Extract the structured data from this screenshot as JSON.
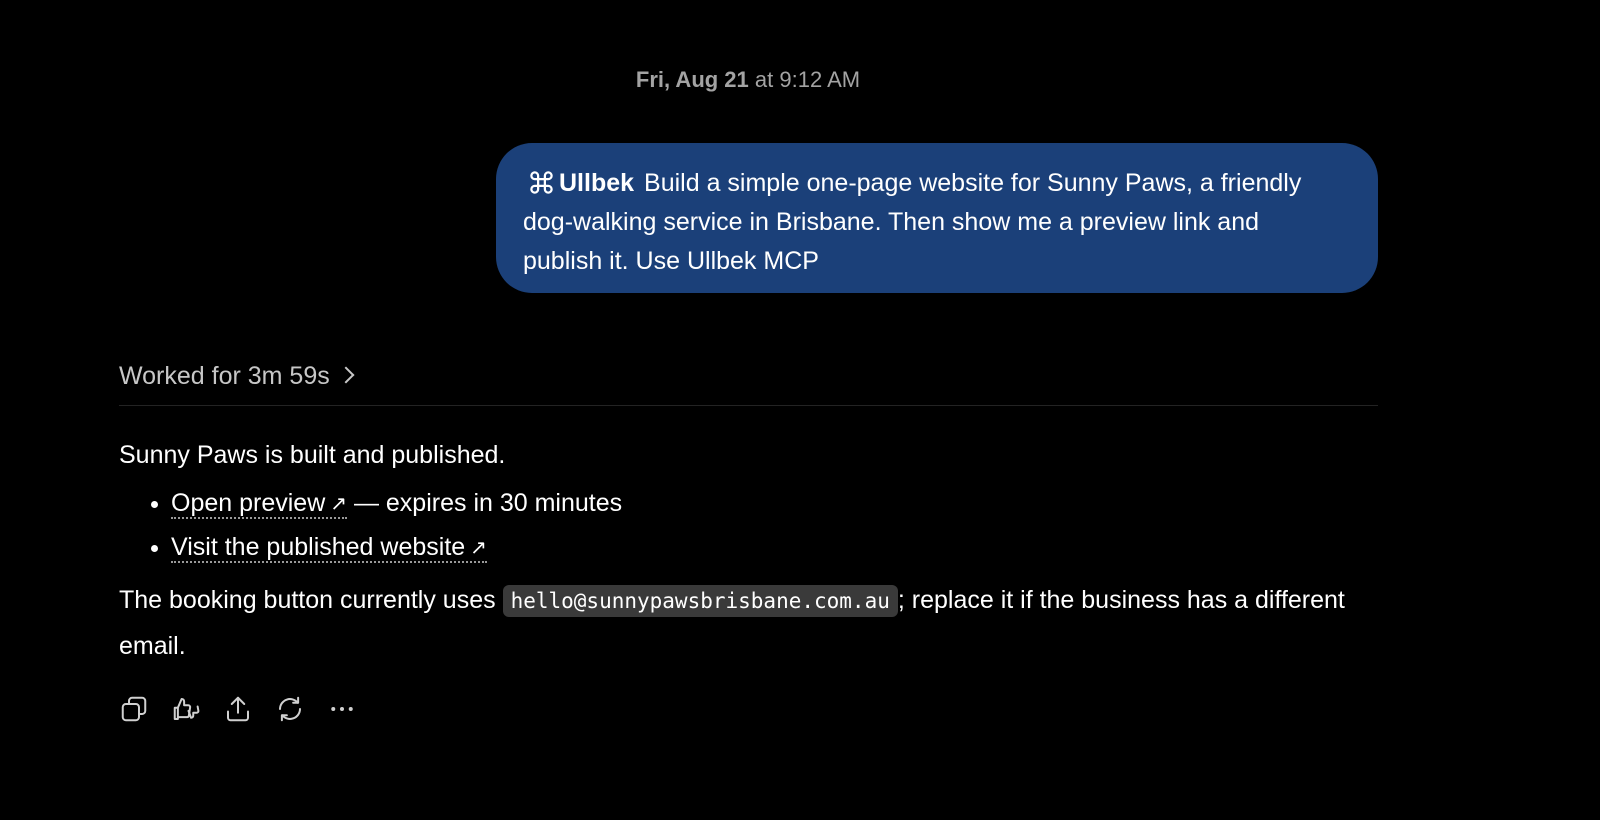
{
  "timestamp": {
    "date": "Fri, Aug 21",
    "at": " at ",
    "time": "9:12 AM"
  },
  "user_message": {
    "mention_icon": "command-icon",
    "mention": "Ullbek",
    "text": "Build a simple one-page website for Sunny Paws, a friendly dog-walking service in Brisbane. Then show me a preview link and publish it. Use Ullbek MCP",
    "bubble_color": "#1b4079"
  },
  "worked": {
    "label": "Worked for 3m 59s"
  },
  "answer": {
    "intro": "Sunny Paws is built and published.",
    "links": [
      {
        "text": "Open preview",
        "arrow": "↗",
        "suffix": " — expires in 30 minutes"
      },
      {
        "text": "Visit the published website",
        "arrow": "↗",
        "suffix": ""
      }
    ],
    "para_before": "The booking button currently uses ",
    "email": "hello@sunnypawsbrisbane.com.au",
    "para_after": "; replace it if the business has a different email."
  },
  "actions": [
    "copy-icon",
    "thumbs-up-down-icon",
    "share-icon",
    "regenerate-icon",
    "more-icon"
  ]
}
